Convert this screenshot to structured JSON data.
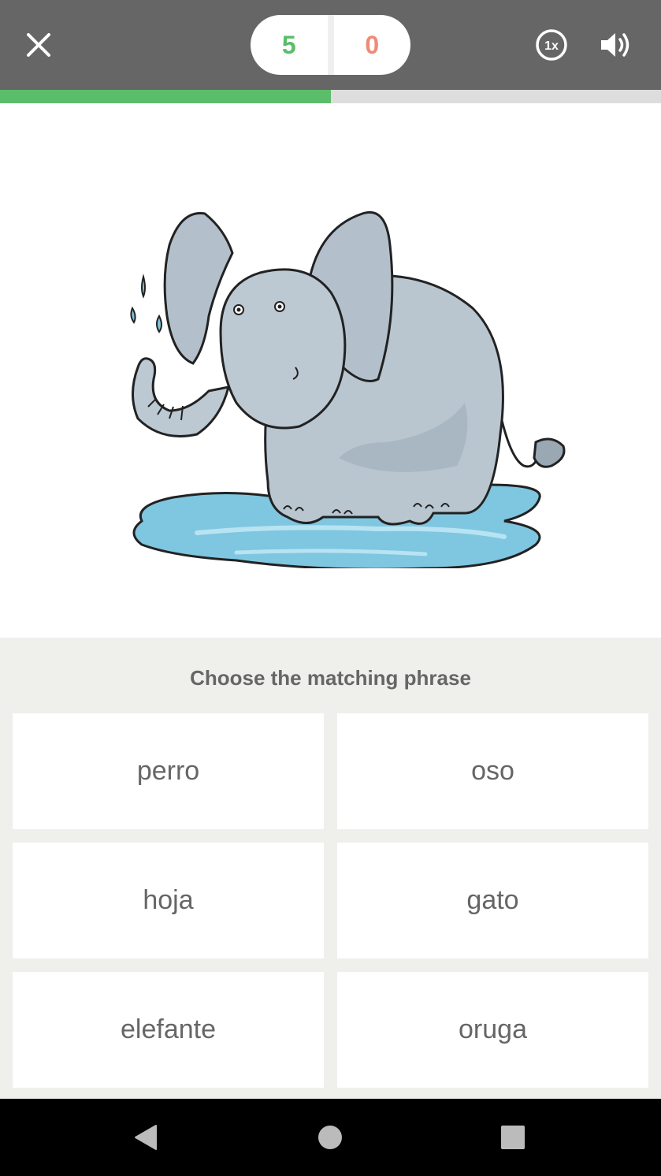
{
  "header": {
    "close_icon": "close-icon",
    "score": {
      "correct": "5",
      "wrong": "0",
      "correct_color": "#5bbd6a",
      "wrong_color": "#f08a78"
    },
    "speed_label": "1x",
    "sound_icon": "speaker-icon"
  },
  "progress": {
    "fraction": 0.5,
    "fill_color": "#5bbd6a"
  },
  "illustration": {
    "icon": "elephant-in-puddle"
  },
  "quiz": {
    "prompt": "Choose the matching phrase",
    "choices": [
      "perro",
      "oso",
      "hoja",
      "gato",
      "elefante",
      "oruga"
    ]
  },
  "navbar": {
    "icons": [
      "back-icon",
      "home-icon",
      "recents-icon"
    ]
  }
}
